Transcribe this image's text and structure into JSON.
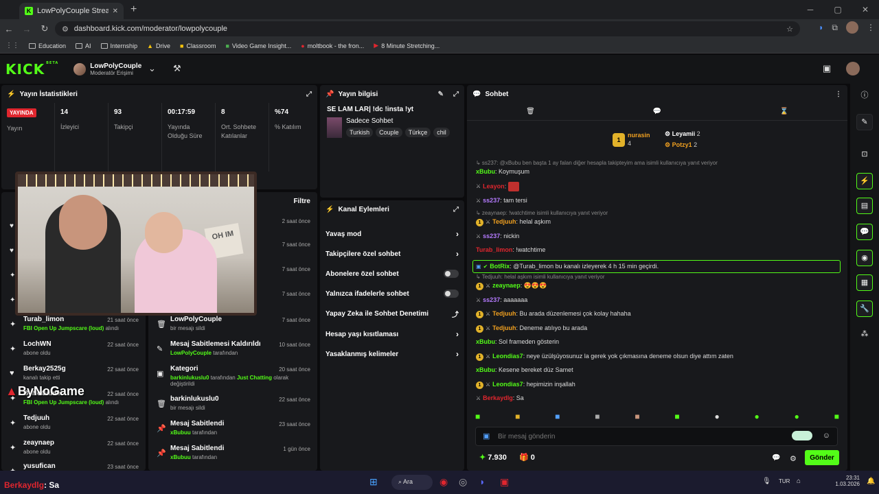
{
  "browser": {
    "tab_title": "LowPolyCouple Stream - Kick D",
    "url": "dashboard.kick.com/moderator/lowpolycouple",
    "bookmarks": [
      "Education",
      "AI",
      "Internship",
      "Drive",
      "Classroom",
      "Video Game Insight...",
      "moltbook - the fron...",
      "8 Minute Stretching..."
    ]
  },
  "header": {
    "logo": "KICK",
    "beta": "BETA",
    "channel_name": "LowPolyCouple",
    "channel_sub": "Moderatör Erişimi"
  },
  "stats_panel": {
    "title": "Yayın İstatistikleri",
    "live": "YAYINDA",
    "live_label": "Yayın",
    "items": [
      {
        "value": "14",
        "label": "İzleyici"
      },
      {
        "value": "93",
        "label": "Takipçi"
      },
      {
        "value": "00:17:59",
        "label": "Yayında Olduğu Süre"
      },
      {
        "value": "8",
        "label": "Ort. Sohbete Katılanlar"
      },
      {
        "value": "%74",
        "label": "% Katılım"
      }
    ]
  },
  "info_panel": {
    "title": "Yayın bilgisi",
    "stream_title": "SE LAM LAR| !dc !insta !yt",
    "category": "Sadece Sohbet",
    "tags": [
      "Turkish",
      "Couple",
      "Türkçe",
      "chil"
    ]
  },
  "webcam": {
    "pillow_text": "OH IM"
  },
  "activity": {
    "filter": "Filtre",
    "left": [
      {
        "name": "Turab_limon",
        "desc_green": "FBI Open Up Jumpscare (loud)",
        "desc": " alındı",
        "time": "21 saat önce",
        "icon": "gift-icon",
        "glyph": "✦"
      },
      {
        "name": "LochWN",
        "desc_green": "",
        "desc": "abone oldu",
        "time": "22 saat önce",
        "icon": "star-icon",
        "glyph": "✦"
      },
      {
        "name": "Berkay2525g",
        "desc_green": "",
        "desc": "kanalı takip etti",
        "time": "22 saat önce",
        "icon": "heart-icon",
        "glyph": "♥"
      },
      {
        "name": "ByNoGame",
        "desc_green": "FBI Open Up Jumpscare (loud)",
        "desc": " alındı",
        "time": "22 saat önce",
        "icon": "gift-icon",
        "glyph": "✦"
      },
      {
        "name": "Tedjuuh",
        "desc_green": "",
        "desc": "abone oldu",
        "time": "22 saat önce",
        "icon": "star-icon",
        "glyph": "✦"
      },
      {
        "name": "zeaynaep",
        "desc_green": "",
        "desc": "abone oldu",
        "time": "22 saat önce",
        "icon": "star-icon",
        "glyph": "✦"
      },
      {
        "name": "yusufican",
        "desc_green": "",
        "desc": "",
        "time": "23 saat önce",
        "icon": "star-icon",
        "glyph": "✦"
      }
    ],
    "left_partial_times": [
      "2 saat önce",
      "7 saat önce",
      "7 saat önce",
      "7 saat önce"
    ],
    "right": [
      {
        "name": "LowPolyCouple",
        "desc_green": "",
        "desc": "bir mesajı sildi",
        "desc2": "",
        "time": "7 saat önce",
        "icon": "trash-icon",
        "glyph": "🗑"
      },
      {
        "name": "Mesaj Sabitlemesi Kaldırıldı",
        "desc_green": "LowPolyCouple",
        "desc": " tarafından",
        "desc2": "",
        "time": "10 saat önce",
        "icon": "unpin-icon",
        "glyph": "✎"
      },
      {
        "name": "Kategori",
        "desc_green": "barkinlukuslu0",
        "desc": " tarafından ",
        "desc_green2": "Just Chatting",
        "desc3": " olarak",
        "desc2": "değiştirildi",
        "time": "20 saat önce",
        "icon": "category-icon",
        "glyph": "▣"
      },
      {
        "name": "barkinlukuslu0",
        "desc_green": "",
        "desc": "bir mesajı sildi",
        "desc2": "",
        "time": "22 saat önce",
        "icon": "trash-icon",
        "glyph": "🗑"
      },
      {
        "name": "Mesaj Sabitlendi",
        "desc_green": "xBubuu",
        "desc": " tarafından",
        "desc2": "",
        "time": "23 saat önce",
        "icon": "pin-icon",
        "glyph": "📌"
      },
      {
        "name": "Mesaj Sabitlendi",
        "desc_green": "xBubuu",
        "desc": " tarafından",
        "desc2": "",
        "time": "1 gün önce",
        "icon": "pin-icon",
        "glyph": "📌"
      }
    ]
  },
  "actions_panel": {
    "title": "Kanal Eylemleri",
    "items": [
      {
        "label": "Yavaş mod",
        "kind": "chevron"
      },
      {
        "label": "Takipçilere özel sohbet",
        "kind": "chevron"
      },
      {
        "label": "Abonelere özel sohbet",
        "kind": "toggle"
      },
      {
        "label": "Yalnızca ifadelerle sohbet",
        "kind": "toggle"
      },
      {
        "label": "Yapay Zeka ile Sohbet Denetimi",
        "kind": "external"
      },
      {
        "label": "Hesap yaşı kısıtlaması",
        "kind": "chevron"
      },
      {
        "label": "Yasaklanmış kelimeler",
        "kind": "chevron"
      }
    ]
  },
  "chat": {
    "title": "Sohbet",
    "leaders": {
      "first_name": "nurasin",
      "first_count": "4",
      "first_rank": "1",
      "second_name": "Leyamii",
      "second_count": "2",
      "third_name": "Potzy1",
      "third_count": "2"
    },
    "top_reply": "↳ ss237: @xBubu ben başta 1 ay falan diğer hesapla takipteyim ama isimli kullanıcıya yanıt veriyor",
    "messages": [
      {
        "user": "xBubu",
        "text": "Koymuşum",
        "color": "#53fc18",
        "badge": "",
        "mod": false,
        "reply": ""
      },
      {
        "user": "Leayon",
        "text": "",
        "color": "#e0262e",
        "badge": "",
        "mod": true,
        "reply": "",
        "emote": true
      },
      {
        "user": "ss237",
        "text": "tam tersi",
        "color": "#b57bff",
        "badge": "",
        "mod": true,
        "reply": ""
      },
      {
        "user": "Tedjuuh",
        "text": "helal aşkım",
        "color": "#f0a020",
        "badge": "1",
        "mod": true,
        "reply": "↳ zeaynaep: !watchtime isimli kullanıcıya yanıt veriyor"
      },
      {
        "user": "ss237",
        "text": "nickin",
        "color": "#b57bff",
        "badge": "",
        "mod": true,
        "reply": ""
      },
      {
        "user": "Turab_limon",
        "text": "!watchtime",
        "color": "#e0262e",
        "badge": "",
        "mod": false,
        "reply": ""
      },
      {
        "user": "BotRix",
        "text": "@Turab_limon bu kanalı izleyerek 4 h 15 min geçirdi.",
        "color": "#53fc18",
        "badge": "",
        "mod": false,
        "reply": "",
        "bot": true
      },
      {
        "user": "zeaynaep",
        "text": "😍😍😍",
        "color": "#53fc18",
        "badge": "1",
        "mod": true,
        "reply": "↳ Tedjuuh: helal aşkım isimli kullanıcıya yanıt veriyor"
      },
      {
        "user": "ss237",
        "text": "aaaaaaa",
        "color": "#b57bff",
        "badge": "",
        "mod": true,
        "reply": ""
      },
      {
        "user": "Tedjuuh",
        "text": "Bu arada düzenlemesi çok kolay hahaha",
        "color": "#f0a020",
        "badge": "1",
        "mod": true,
        "reply": ""
      },
      {
        "user": "Tedjuuh",
        "text": "Deneme atılıyo bu arada",
        "color": "#f0a020",
        "badge": "1",
        "mod": true,
        "reply": ""
      },
      {
        "user": "xBubu",
        "text": "Sol frameden gösterin",
        "color": "#53fc18",
        "badge": "",
        "mod": false,
        "reply": ""
      },
      {
        "user": "Leondias7",
        "text": "neye üzülşüyosunuz la gerek yok çıkmasına deneme olsun diye attım zaten",
        "color": "#53fc18",
        "badge": "1",
        "mod": true,
        "reply": ""
      },
      {
        "user": "xBubu",
        "text": "Kesene bereket düz Samet",
        "color": "#53fc18",
        "badge": "",
        "mod": false,
        "reply": ""
      },
      {
        "user": "Leondias7",
        "text": "hepimizin inşallah",
        "color": "#53fc18",
        "badge": "1",
        "mod": true,
        "reply": ""
      },
      {
        "user": "Berkaydlg",
        "text": "Sa",
        "color": "#e0262e",
        "badge": "",
        "mod": true,
        "reply": ""
      }
    ],
    "input_placeholder": "Bir mesaj gönderin",
    "points": "7.930",
    "gifts": "0",
    "send": "Gönder"
  },
  "overlays": {
    "bynogame": "ByNoGame",
    "bottom_user": "Berkaydlg",
    "bottom_text": ": Sa"
  },
  "taskbar": {
    "search": "Ara",
    "lang": "TUR",
    "time": "23:31",
    "date": "1.03.2026"
  },
  "colors": {
    "accent": "#53fc18",
    "live": "#e0262e"
  }
}
